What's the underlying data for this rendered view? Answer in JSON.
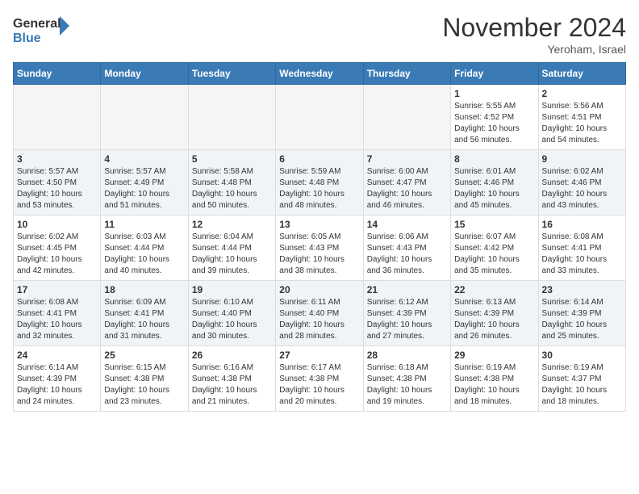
{
  "header": {
    "logo_general": "General",
    "logo_blue": "Blue",
    "month_title": "November 2024",
    "location": "Yeroham, Israel"
  },
  "weekdays": [
    "Sunday",
    "Monday",
    "Tuesday",
    "Wednesday",
    "Thursday",
    "Friday",
    "Saturday"
  ],
  "weeks": [
    [
      {
        "day": "",
        "info": ""
      },
      {
        "day": "",
        "info": ""
      },
      {
        "day": "",
        "info": ""
      },
      {
        "day": "",
        "info": ""
      },
      {
        "day": "",
        "info": ""
      },
      {
        "day": "1",
        "info": "Sunrise: 5:55 AM\nSunset: 4:52 PM\nDaylight: 10 hours\nand 56 minutes."
      },
      {
        "day": "2",
        "info": "Sunrise: 5:56 AM\nSunset: 4:51 PM\nDaylight: 10 hours\nand 54 minutes."
      }
    ],
    [
      {
        "day": "3",
        "info": "Sunrise: 5:57 AM\nSunset: 4:50 PM\nDaylight: 10 hours\nand 53 minutes."
      },
      {
        "day": "4",
        "info": "Sunrise: 5:57 AM\nSunset: 4:49 PM\nDaylight: 10 hours\nand 51 minutes."
      },
      {
        "day": "5",
        "info": "Sunrise: 5:58 AM\nSunset: 4:48 PM\nDaylight: 10 hours\nand 50 minutes."
      },
      {
        "day": "6",
        "info": "Sunrise: 5:59 AM\nSunset: 4:48 PM\nDaylight: 10 hours\nand 48 minutes."
      },
      {
        "day": "7",
        "info": "Sunrise: 6:00 AM\nSunset: 4:47 PM\nDaylight: 10 hours\nand 46 minutes."
      },
      {
        "day": "8",
        "info": "Sunrise: 6:01 AM\nSunset: 4:46 PM\nDaylight: 10 hours\nand 45 minutes."
      },
      {
        "day": "9",
        "info": "Sunrise: 6:02 AM\nSunset: 4:46 PM\nDaylight: 10 hours\nand 43 minutes."
      }
    ],
    [
      {
        "day": "10",
        "info": "Sunrise: 6:02 AM\nSunset: 4:45 PM\nDaylight: 10 hours\nand 42 minutes."
      },
      {
        "day": "11",
        "info": "Sunrise: 6:03 AM\nSunset: 4:44 PM\nDaylight: 10 hours\nand 40 minutes."
      },
      {
        "day": "12",
        "info": "Sunrise: 6:04 AM\nSunset: 4:44 PM\nDaylight: 10 hours\nand 39 minutes."
      },
      {
        "day": "13",
        "info": "Sunrise: 6:05 AM\nSunset: 4:43 PM\nDaylight: 10 hours\nand 38 minutes."
      },
      {
        "day": "14",
        "info": "Sunrise: 6:06 AM\nSunset: 4:43 PM\nDaylight: 10 hours\nand 36 minutes."
      },
      {
        "day": "15",
        "info": "Sunrise: 6:07 AM\nSunset: 4:42 PM\nDaylight: 10 hours\nand 35 minutes."
      },
      {
        "day": "16",
        "info": "Sunrise: 6:08 AM\nSunset: 4:41 PM\nDaylight: 10 hours\nand 33 minutes."
      }
    ],
    [
      {
        "day": "17",
        "info": "Sunrise: 6:08 AM\nSunset: 4:41 PM\nDaylight: 10 hours\nand 32 minutes."
      },
      {
        "day": "18",
        "info": "Sunrise: 6:09 AM\nSunset: 4:41 PM\nDaylight: 10 hours\nand 31 minutes."
      },
      {
        "day": "19",
        "info": "Sunrise: 6:10 AM\nSunset: 4:40 PM\nDaylight: 10 hours\nand 30 minutes."
      },
      {
        "day": "20",
        "info": "Sunrise: 6:11 AM\nSunset: 4:40 PM\nDaylight: 10 hours\nand 28 minutes."
      },
      {
        "day": "21",
        "info": "Sunrise: 6:12 AM\nSunset: 4:39 PM\nDaylight: 10 hours\nand 27 minutes."
      },
      {
        "day": "22",
        "info": "Sunrise: 6:13 AM\nSunset: 4:39 PM\nDaylight: 10 hours\nand 26 minutes."
      },
      {
        "day": "23",
        "info": "Sunrise: 6:14 AM\nSunset: 4:39 PM\nDaylight: 10 hours\nand 25 minutes."
      }
    ],
    [
      {
        "day": "24",
        "info": "Sunrise: 6:14 AM\nSunset: 4:39 PM\nDaylight: 10 hours\nand 24 minutes."
      },
      {
        "day": "25",
        "info": "Sunrise: 6:15 AM\nSunset: 4:38 PM\nDaylight: 10 hours\nand 23 minutes."
      },
      {
        "day": "26",
        "info": "Sunrise: 6:16 AM\nSunset: 4:38 PM\nDaylight: 10 hours\nand 21 minutes."
      },
      {
        "day": "27",
        "info": "Sunrise: 6:17 AM\nSunset: 4:38 PM\nDaylight: 10 hours\nand 20 minutes."
      },
      {
        "day": "28",
        "info": "Sunrise: 6:18 AM\nSunset: 4:38 PM\nDaylight: 10 hours\nand 19 minutes."
      },
      {
        "day": "29",
        "info": "Sunrise: 6:19 AM\nSunset: 4:38 PM\nDaylight: 10 hours\nand 18 minutes."
      },
      {
        "day": "30",
        "info": "Sunrise: 6:19 AM\nSunset: 4:37 PM\nDaylight: 10 hours\nand 18 minutes."
      }
    ]
  ]
}
